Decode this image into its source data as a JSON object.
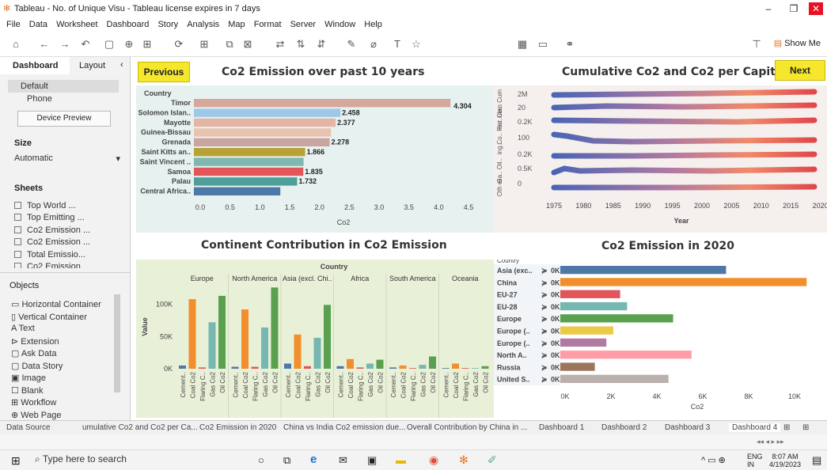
{
  "window": {
    "title": "Tableau - No. of Unique Visu - Tableau license expires in 7 days"
  },
  "menu": [
    "File",
    "Data",
    "Worksheet",
    "Dashboard",
    "Story",
    "Analysis",
    "Map",
    "Format",
    "Server",
    "Window",
    "Help"
  ],
  "toolbar": {
    "show_me": "Show Me"
  },
  "left_panel": {
    "tab_dashboard": "Dashboard",
    "tab_layout": "Layout",
    "devices": [
      "Default",
      "Phone"
    ],
    "device_preview": "Device Preview",
    "size_label": "Size",
    "size_value": "Automatic",
    "sheets_label": "Sheets",
    "sheets": [
      "Top World ...",
      "Top Emitting ...",
      "Co2 Emission ...",
      "Co2 Emission ...",
      "Total Emissio...",
      "Co2 Emission"
    ],
    "objects_label": "Objects",
    "objects": [
      "Horizontal Container",
      "Vertical Container",
      "Text",
      "Extension",
      "Ask Data",
      "Data Story",
      "Image",
      "Blank",
      "Workflow",
      "Web Page"
    ]
  },
  "dashboard": {
    "previous": "Previous",
    "next": "Next",
    "title1": "Co2 Emission over past 10 years",
    "title2": "Cumulative Co2 and Co2 per Capita",
    "title3": "Continent Contribution in Co2 Emission",
    "title4": "Co2 Emission in 2020"
  },
  "chart_data": [
    {
      "type": "bar",
      "title": "Co2 Emission over past 10 years",
      "ylabel": "Country",
      "xlabel": "Co2",
      "categories": [
        "Timor",
        "Solomon Islan..",
        "Mayotte",
        "Guinea-Bissau",
        "Grenada",
        "Saint Kitts an..",
        "Saint Vincent ..",
        "Samoa",
        "Palau",
        "Central Africa.."
      ],
      "values": [
        4.304,
        2.458,
        2.377,
        2.3,
        2.278,
        1.866,
        1.84,
        1.835,
        1.732,
        1.45
      ],
      "labels": [
        "4.304",
        "2.458",
        "2.377",
        "",
        "2.278",
        "1.866",
        "",
        "1.835",
        "1.732",
        ""
      ],
      "colors": [
        "#d4a89a",
        "#9ec9e6",
        "#e3b5a4",
        "#e8c3b0",
        "#c9a4a0",
        "#b8a236",
        "#7fb8b0",
        "#e15759",
        "#4e9e9a",
        "#4e79a7"
      ],
      "xticks": [
        "0.0",
        "0.5",
        "1.0",
        "1.5",
        "2.0",
        "2.5",
        "3.0",
        "3.5",
        "4.0",
        "4.5"
      ],
      "xlim": [
        0,
        4.5
      ]
    },
    {
      "type": "line",
      "title": "Cumulative Co2 and Co2 per Capita",
      "xlabel": "Year",
      "x_ticks": [
        "1975",
        "1980",
        "1985",
        "1990",
        "1995",
        "2000",
        "2005",
        "2010",
        "2015",
        "2020"
      ],
      "row_labels": [
        "Cem Cum",
        "ent..ula..",
        "Co.. Flar",
        "ing..",
        "Ga.. Oil..",
        "Oth er"
      ],
      "yticks": [
        "2M",
        "20",
        "0.2K",
        "100",
        "0.2K",
        "0.5K",
        "0"
      ]
    },
    {
      "type": "bar",
      "title": "Continent Contribution in Co2 Emission",
      "xlabel": "Country",
      "ylabel": "Value",
      "groups": [
        "Europe",
        "North America",
        "Asia (excl. Chi..",
        "Africa",
        "South America",
        "Oceania"
      ],
      "categories": [
        "Cement..",
        "Coal Co2",
        "Flaring C..",
        "Gas Co2",
        "Oil Co2"
      ],
      "series": [
        {
          "name": "Europe",
          "values": [
            5,
            108,
            2,
            72,
            113
          ]
        },
        {
          "name": "North America",
          "values": [
            3,
            92,
            3,
            64,
            126
          ]
        },
        {
          "name": "Asia (excl. Chi..",
          "values": [
            8,
            53,
            4,
            48,
            99
          ]
        },
        {
          "name": "Africa",
          "values": [
            4,
            15,
            2,
            8,
            14
          ]
        },
        {
          "name": "South America",
          "values": [
            2,
            5,
            1,
            6,
            19
          ]
        },
        {
          "name": "Oceania",
          "values": [
            1,
            8,
            1,
            1,
            4
          ]
        }
      ],
      "yticks": [
        "0K",
        "50K",
        "100K"
      ],
      "ylim": [
        0,
        135
      ]
    },
    {
      "type": "bar",
      "title": "Co2 Emission in 2020",
      "xlabel": "Co2",
      "ylabel": "Country",
      "categories": [
        "Asia (exc..",
        "China",
        "EU-27",
        "EU-28",
        "Europe",
        "Europe (..",
        "Europe (..",
        "North A..",
        "Russia",
        "United S.."
      ],
      "values": [
        7.2,
        10.7,
        2.6,
        2.9,
        4.9,
        2.3,
        2.0,
        5.7,
        1.5,
        4.7
      ],
      "zero_labels": [
        "0K",
        "0K",
        "0K",
        "0K",
        "0K",
        "0K",
        "0K",
        "0K",
        "0K",
        "0K"
      ],
      "colors": [
        "#4e79a7",
        "#f28e2b",
        "#e15759",
        "#76b7b2",
        "#59a14f",
        "#edc948",
        "#b07aa1",
        "#ff9da7",
        "#9c755f",
        "#bab0ac"
      ],
      "xticks": [
        "0K",
        "2K",
        "4K",
        "6K",
        "8K",
        "10K"
      ],
      "xlim": [
        0,
        11
      ]
    }
  ],
  "bottom_tabs": [
    "Data Source",
    "umulative Co2 and Co2 per Ca...",
    "Co2 Emission in 2020",
    "China vs India Co2 emission due...",
    "Overall Contribution by China in ...",
    "Dashboard 1",
    "Dashboard 2",
    "Dashboard 3",
    "Dashboard 4"
  ],
  "taskbar": {
    "search_placeholder": "Type here to search",
    "lang": "ENG",
    "region": "IN",
    "time": "8:07 AM",
    "date": "4/19/2023"
  }
}
